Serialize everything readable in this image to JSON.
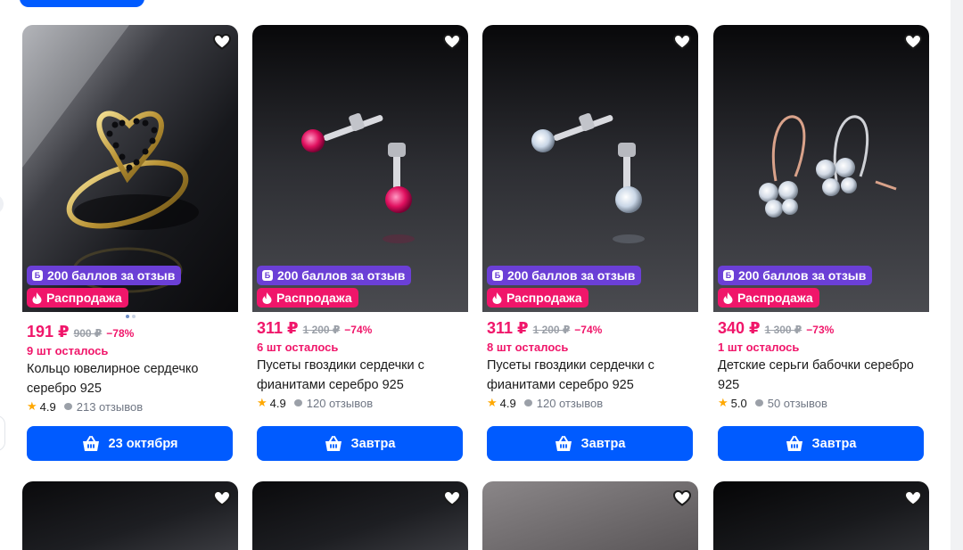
{
  "colors": {
    "accent": "#005bff",
    "price": "#f0166a",
    "points_badge": "#6b3fd6",
    "sale_badge": "#f0166a",
    "star": "#ffa800"
  },
  "icons": {
    "favorite": "heart-icon",
    "points": "b-icon",
    "sale": "fire-icon",
    "cart": "basket-icon",
    "star": "star-icon",
    "reviews": "chat-bubble-icon"
  },
  "products": [
    {
      "image": "gold ring with heart and black stones",
      "points_badge": "200 баллов за отзыв",
      "sale_badge": "Распродажа",
      "price": "191 ₽",
      "old_price": "900 ₽",
      "discount": "−78%",
      "stock": "9 шт осталось",
      "title": "Кольцо ювелирное сердечко серебро 925",
      "rating": "4.9",
      "reviews": "213 отзывов",
      "delivery": "23 октября"
    },
    {
      "image": "silver stud earrings with pink stones",
      "points_badge": "200 баллов за отзыв",
      "sale_badge": "Распродажа",
      "price": "311 ₽",
      "old_price": "1 200 ₽",
      "discount": "−74%",
      "stock": "6 шт осталось",
      "title": "Пусеты гвоздики сердечки с фианитами серебро 925",
      "rating": "4.9",
      "reviews": "120 отзывов",
      "delivery": "Завтра"
    },
    {
      "image": "silver stud earrings with clear stones",
      "points_badge": "200 баллов за отзыв",
      "sale_badge": "Распродажа",
      "price": "311 ₽",
      "old_price": "1 200 ₽",
      "discount": "−74%",
      "stock": "8 шт осталось",
      "title": "Пусеты гвоздики сердечки с фианитами серебро 925",
      "rating": "4.9",
      "reviews": "120 отзывов",
      "delivery": "Завтра"
    },
    {
      "image": "butterfly hook earrings with clear stones",
      "points_badge": "200 баллов за отзыв",
      "sale_badge": "Распродажа",
      "price": "340 ₽",
      "old_price": "1 300 ₽",
      "discount": "−73%",
      "stock": "1 шт осталось",
      "title": "Детские серьги бабочки серебро 925",
      "rating": "5.0",
      "reviews": "50 отзывов",
      "delivery": "Завтра"
    }
  ]
}
